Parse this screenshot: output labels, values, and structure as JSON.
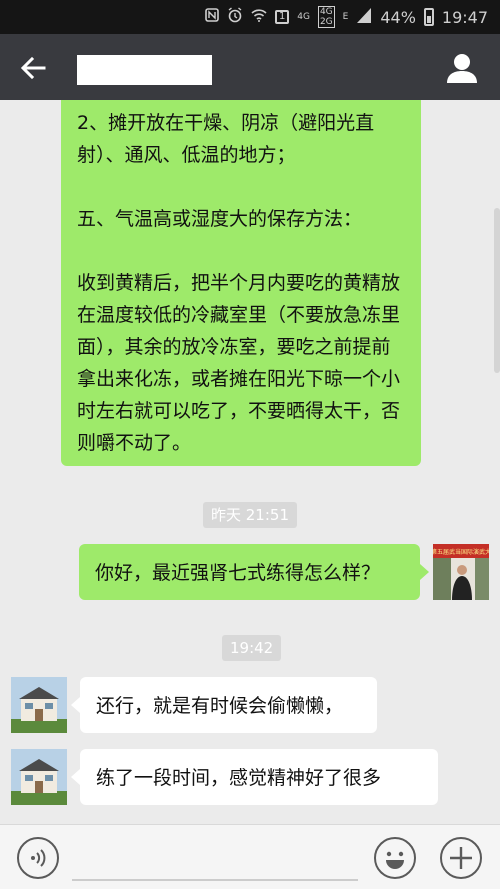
{
  "status_bar": {
    "network_type": "4G",
    "network_dual": "4G\n2G",
    "roaming_letter": "E",
    "sim_badge": "1",
    "battery": "44%",
    "time": "19:47"
  },
  "header": {
    "back_icon": "arrow-left-icon",
    "profile_icon": "person-icon"
  },
  "messages": {
    "long_bubble": {
      "line1": "2、摊开放在干燥、阴凉（避阳光直射）、通风、低温的地方；",
      "line2": "五、气温高或湿度大的保存方法：",
      "line3": "收到黄精后，把半个月内要吃的黄精放在温度较低的冷藏室里（不要放急冻里面），其余的放冷冻室，要吃之前提前拿出来化冻，或者摊在阳光下晾一个小时左右就可以吃了，不要晒得太干，否则嚼不动了。"
    },
    "timestamp1": "昨天 21:51",
    "msg_sent": "你好，最近强肾七式练得怎么样？",
    "timestamp2": "19:42",
    "msg_recv1": "还行，就是有时候会偷懒懒，",
    "msg_recv2": "练了一段时间，感觉精神好了很多"
  },
  "avatar_banner_text": "第五届武当国际演武大",
  "input_bar": {
    "voice_icon": "voice-icon",
    "emoji_icon": "smiley-icon",
    "plus_icon": "plus-icon"
  }
}
